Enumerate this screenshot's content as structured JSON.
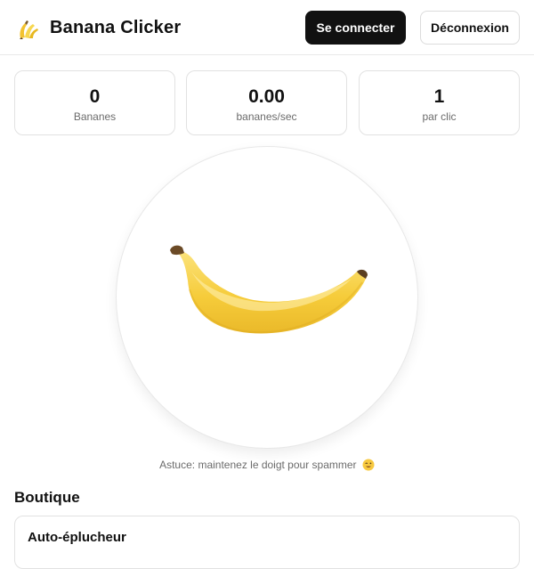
{
  "header": {
    "logo_icon": "banana-icon",
    "title": "Banana Clicker",
    "login_label": "Se connecter",
    "logout_label": "Déconnexion"
  },
  "stats": [
    {
      "value": "0",
      "label": "Bananes"
    },
    {
      "value": "0.00",
      "label": "bananes/sec"
    },
    {
      "value": "1",
      "label": "par clic"
    }
  ],
  "clicker": {
    "image_icon": "banana-icon",
    "tip": "Astuce: maintenez le doigt pour spammer",
    "tip_icon": "winking-face-icon"
  },
  "shop": {
    "title": "Boutique",
    "items": [
      {
        "name": "Auto-éplucheur"
      }
    ]
  },
  "colors": {
    "primary_button": "#111111",
    "banana_yellow": "#f7cf3c",
    "border": "#e2e2e2"
  }
}
